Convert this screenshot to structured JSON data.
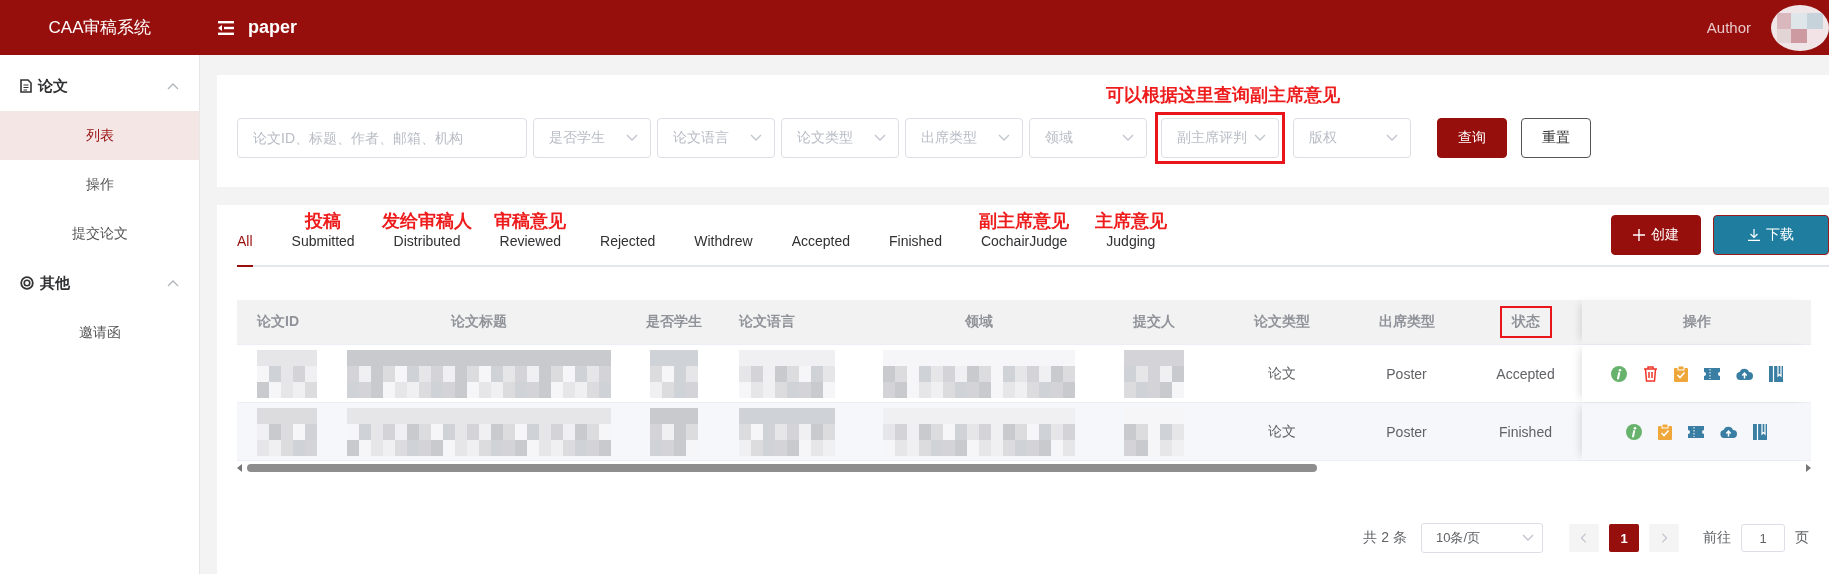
{
  "header": {
    "logo": "CAA审稿系统",
    "page_title": "paper",
    "user": "Author"
  },
  "sidebar": {
    "groups": [
      {
        "title": "论文",
        "expanded": true,
        "items": [
          {
            "label": "列表",
            "selected": true
          },
          {
            "label": "操作",
            "selected": false
          },
          {
            "label": "提交论文",
            "selected": false
          }
        ]
      },
      {
        "title": "其他",
        "expanded": true,
        "items": [
          {
            "label": "邀请函",
            "selected": false
          }
        ]
      }
    ]
  },
  "filters": {
    "note": "可以根据这里查询副主席意见",
    "search": {
      "placeholder": "论文ID、标题、作者、邮箱、机构"
    },
    "selects": [
      {
        "placeholder": "是否学生",
        "highlighted": false
      },
      {
        "placeholder": "论文语言",
        "highlighted": false
      },
      {
        "placeholder": "论文类型",
        "highlighted": false
      },
      {
        "placeholder": "出席类型",
        "highlighted": false
      },
      {
        "placeholder": "领域",
        "highlighted": false
      },
      {
        "placeholder": "副主席评判",
        "highlighted": true
      },
      {
        "placeholder": "版权",
        "highlighted": false
      }
    ],
    "buttons": [
      {
        "label": "查询",
        "kind": "primary"
      },
      {
        "label": "重置",
        "kind": "plain"
      }
    ]
  },
  "tabs": [
    {
      "label": "All",
      "selected": true
    },
    {
      "label": "Submitted",
      "selected": false,
      "note": "投稿"
    },
    {
      "label": "Distributed",
      "selected": false,
      "note": "发给审稿人"
    },
    {
      "label": "Reviewed",
      "selected": false,
      "note": "审稿意见"
    },
    {
      "label": "Rejected",
      "selected": false
    },
    {
      "label": "Withdrew",
      "selected": false
    },
    {
      "label": "Accepted",
      "selected": false
    },
    {
      "label": "Finished",
      "selected": false
    },
    {
      "label": "CochairJudge",
      "selected": false,
      "note": "副主席意见"
    },
    {
      "label": "Judging",
      "selected": false,
      "note": "主席意见"
    }
  ],
  "actions": [
    {
      "label": "创建",
      "kind": "create"
    },
    {
      "label": "下载",
      "kind": "download"
    }
  ],
  "table": {
    "columns": [
      {
        "label": "论文ID",
        "highlighted": false
      },
      {
        "label": "论文标题",
        "highlighted": false
      },
      {
        "label": "是否学生",
        "highlighted": false
      },
      {
        "label": "论文语言",
        "highlighted": false
      },
      {
        "label": "领域",
        "highlighted": false
      },
      {
        "label": "提交人",
        "highlighted": false
      },
      {
        "label": "论文类型",
        "highlighted": false
      },
      {
        "label": "出席类型",
        "highlighted": false
      },
      {
        "label": "状态",
        "highlighted": true
      },
      {
        "label": "操作",
        "highlighted": false
      }
    ],
    "rows": [
      {
        "cells": [
          {
            "kind": "redacted"
          },
          {
            "kind": "redacted"
          },
          {
            "kind": "redacted"
          },
          {
            "kind": "redacted"
          },
          {
            "kind": "redacted"
          },
          {
            "kind": "redacted"
          },
          {
            "kind": "text",
            "text": "论文"
          },
          {
            "kind": "text",
            "text": "Poster"
          },
          {
            "kind": "text",
            "text": "Accepted"
          }
        ],
        "operations": [
          {
            "kind": "info"
          },
          {
            "kind": "delete"
          },
          {
            "kind": "clipboard"
          },
          {
            "kind": "ticket"
          },
          {
            "kind": "upload"
          },
          {
            "kind": "book"
          }
        ]
      },
      {
        "cells": [
          {
            "kind": "redacted"
          },
          {
            "kind": "redacted"
          },
          {
            "kind": "redacted"
          },
          {
            "kind": "redacted"
          },
          {
            "kind": "redacted"
          },
          {
            "kind": "redacted"
          },
          {
            "kind": "text",
            "text": "论文"
          },
          {
            "kind": "text",
            "text": "Poster"
          },
          {
            "kind": "text",
            "text": "Finished"
          }
        ],
        "operations": [
          {
            "kind": "info"
          },
          {
            "kind": "clipboard"
          },
          {
            "kind": "ticket"
          },
          {
            "kind": "upload"
          },
          {
            "kind": "book"
          }
        ]
      }
    ]
  },
  "pagination": {
    "total": "共 2 条",
    "page_size": "10条/页",
    "pages": [
      {
        "label": "1",
        "selected": true
      }
    ],
    "goto_label": "前往",
    "goto_value": "1",
    "goto_suffix": "页"
  }
}
